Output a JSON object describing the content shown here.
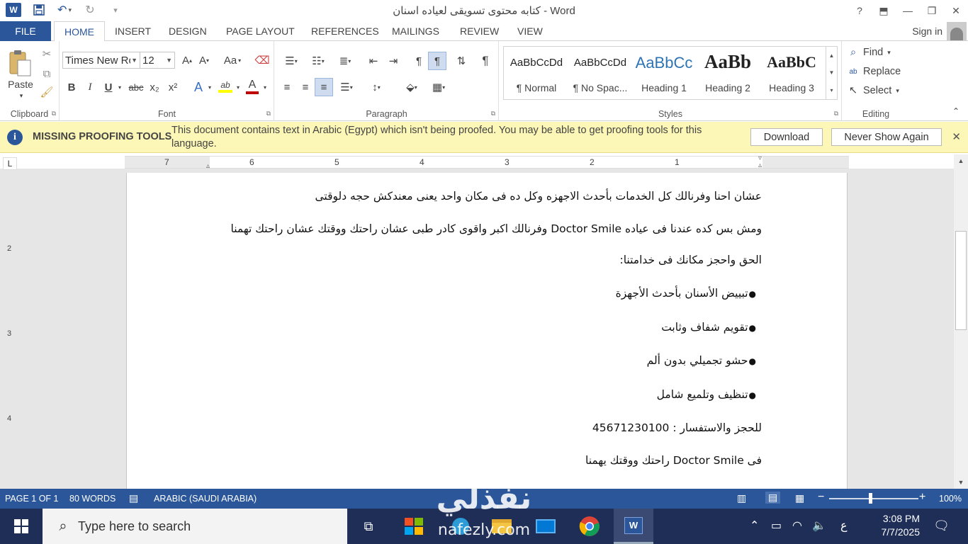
{
  "titlebar": {
    "title": "كتابه محتوى تسويقى لعياده اسنان - Word",
    "app_icon": "W",
    "help": "?",
    "ribbon_opts": "⬒",
    "minimize": "—",
    "restore": "❐",
    "close": "✕"
  },
  "tabs": {
    "file": "FILE",
    "items": [
      "HOME",
      "INSERT",
      "DESIGN",
      "PAGE LAYOUT",
      "REFERENCES",
      "MAILINGS",
      "REVIEW",
      "VIEW"
    ],
    "sign_in": "Sign in"
  },
  "ribbon": {
    "clipboard": {
      "label": "Clipboard",
      "paste": "Paste"
    },
    "font": {
      "label": "Font",
      "font_name": "Times New Roman",
      "font_size": "12",
      "change_case": "Aa",
      "bold": "B",
      "italic": "I",
      "underline": "U",
      "strike": "abc",
      "subscript": "x₂",
      "superscript": "x²",
      "text_effects": "A",
      "highlight": "ab",
      "font_color": "A"
    },
    "paragraph": {
      "label": "Paragraph"
    },
    "styles": {
      "label": "Styles",
      "items": [
        {
          "preview": "AaBbCcDd",
          "name": "¶ Normal"
        },
        {
          "preview": "AaBbCcDd",
          "name": "¶ No Spac..."
        },
        {
          "preview": "AaBbCc",
          "name": "Heading 1"
        },
        {
          "preview": "AaBb",
          "name": "Heading 2"
        },
        {
          "preview": "AaBbC",
          "name": "Heading 3"
        }
      ]
    },
    "editing": {
      "label": "Editing",
      "find": "Find",
      "replace": "Replace",
      "select": "Select"
    }
  },
  "message_bar": {
    "title": "MISSING PROOFING TOOLS",
    "text": "This document contains text in Arabic (Egypt) which isn't being proofed. You may be able to get proofing tools for this language.",
    "download": "Download",
    "never_show": "Never Show Again"
  },
  "ruler": {
    "corner": "L",
    "h_numbers": [
      "7",
      "6",
      "5",
      "4",
      "3",
      "2",
      "1"
    ],
    "v_numbers": [
      "2",
      "3",
      "4"
    ]
  },
  "document": {
    "lines": [
      "عشان احنا وفرنالك كل الخدمات بأحدث الاجهزه وكل ده فى مكان واحد يعنى معندكش حجه دلوقتى",
      "ومش بس كده عندنا فى عياده  Doctor Smile وفرنالك اكبر واقوى كادر طبى عشان راحتك ووقتك عشان راحتك تهمنا",
      "الحق واحجز مكانك فى خدامتنا:",
      "تبييض الأسنان بأحدث الأجهزة",
      "تقويم شفاف وثابت",
      "حشو تجميلي بدون ألم",
      "تنظيف وتلميع شامل",
      "للحجز والاستفسار : 45671230100",
      "فى  Doctor Smile راحتك ووقتك يهمنا"
    ]
  },
  "status_bar": {
    "page": "PAGE 1 OF 1",
    "words": "80 WORDS",
    "language": "ARABIC (SAUDI ARABIA)",
    "zoom": "100%",
    "zoom_fraction": 0.46
  },
  "taskbar": {
    "search_placeholder": "Type here to search",
    "time": "3:08 PM",
    "date": "7/7/2025",
    "input_lang": "ع"
  },
  "watermark": {
    "arabic": "نفذلي",
    "latin": "nafezly.com"
  },
  "colors": {
    "word_blue": "#2b579a",
    "message_bar": "#fcf7b6",
    "taskbar": "#1f2e57"
  }
}
